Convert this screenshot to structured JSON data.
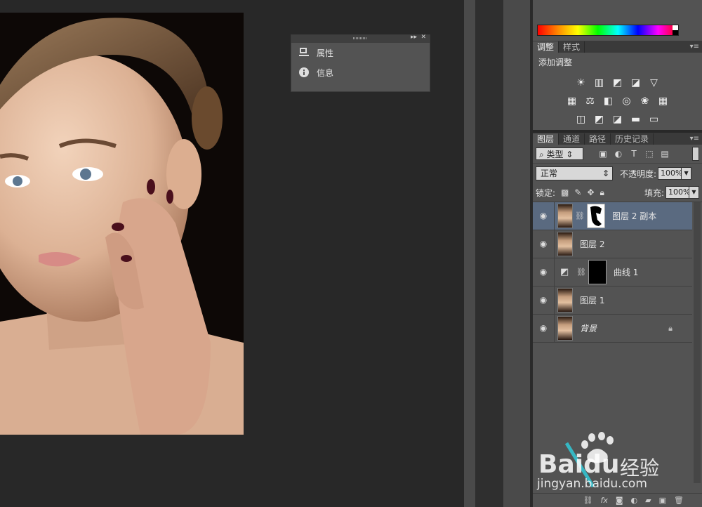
{
  "mini_panel": {
    "items": [
      {
        "label": "属性",
        "icon": "properties-icon"
      },
      {
        "label": "信息",
        "icon": "info-icon"
      }
    ]
  },
  "adjust_panel": {
    "tabs": [
      "调整",
      "样式"
    ],
    "title": "添加调整"
  },
  "layers_panel": {
    "tabs": [
      "图层",
      "通道",
      "路径",
      "历史记录"
    ],
    "filter_kind": "类型",
    "blend_mode": "正常",
    "opacity_label": "不透明度:",
    "opacity_value": "100%",
    "lock_label": "锁定:",
    "fill_label": "填充:",
    "fill_value": "100%",
    "layers": [
      {
        "name": "图层 2 副本",
        "selected": true
      },
      {
        "name": "图层 2"
      },
      {
        "name": "曲线 1"
      },
      {
        "name": "图层 1"
      },
      {
        "name": "背景",
        "locked": true
      }
    ]
  },
  "watermark": {
    "brand": "Bai",
    "brand2": "du",
    "cn": "经验",
    "url": "jingyan.baidu.com"
  }
}
